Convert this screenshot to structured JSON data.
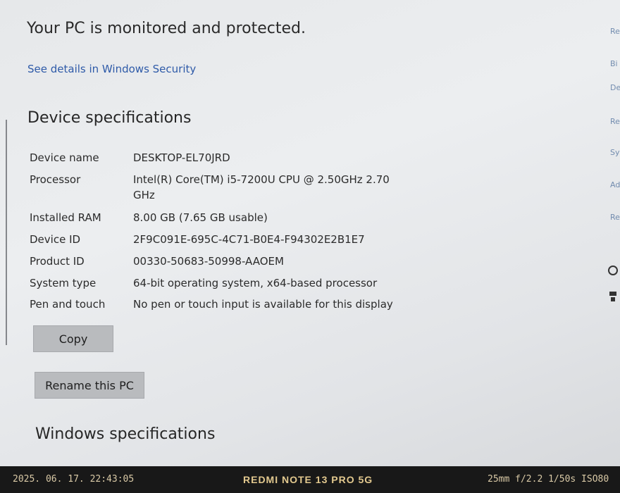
{
  "security": {
    "status_heading": "Your PC is monitored and protected.",
    "details_link": "See details in Windows Security"
  },
  "device_specs": {
    "title": "Device specifications",
    "rows": [
      {
        "label": "Device name",
        "value": "DESKTOP-EL70JRD"
      },
      {
        "label": "Processor",
        "value": "Intel(R) Core(TM) i5-7200U CPU @ 2.50GHz   2.70 GHz"
      },
      {
        "label": "Installed RAM",
        "value": "8.00 GB (7.65 GB usable)"
      },
      {
        "label": "Device ID",
        "value": "2F9C091E-695C-4C71-B0E4-F94302E2B1E7"
      },
      {
        "label": "Product ID",
        "value": "00330-50683-50998-AAOEM"
      },
      {
        "label": "System type",
        "value": "64-bit operating system, x64-based processor"
      },
      {
        "label": "Pen and touch",
        "value": "No pen or touch input is available for this display"
      }
    ],
    "copy_button": "Copy",
    "rename_button": "Rename this PC"
  },
  "windows_specs": {
    "title": "Windows specifications"
  },
  "right_sidebar": {
    "fragments": [
      "Re",
      "Bi",
      "De",
      "Re",
      "Sy",
      "Ad",
      "Re"
    ]
  },
  "camera_watermark": {
    "datetime": "2025. 06. 17.  22:43:05",
    "device": "REDMI NOTE 13 PRO 5G",
    "exposure": "25mm  f/2.2  1/50s  ISO80"
  }
}
